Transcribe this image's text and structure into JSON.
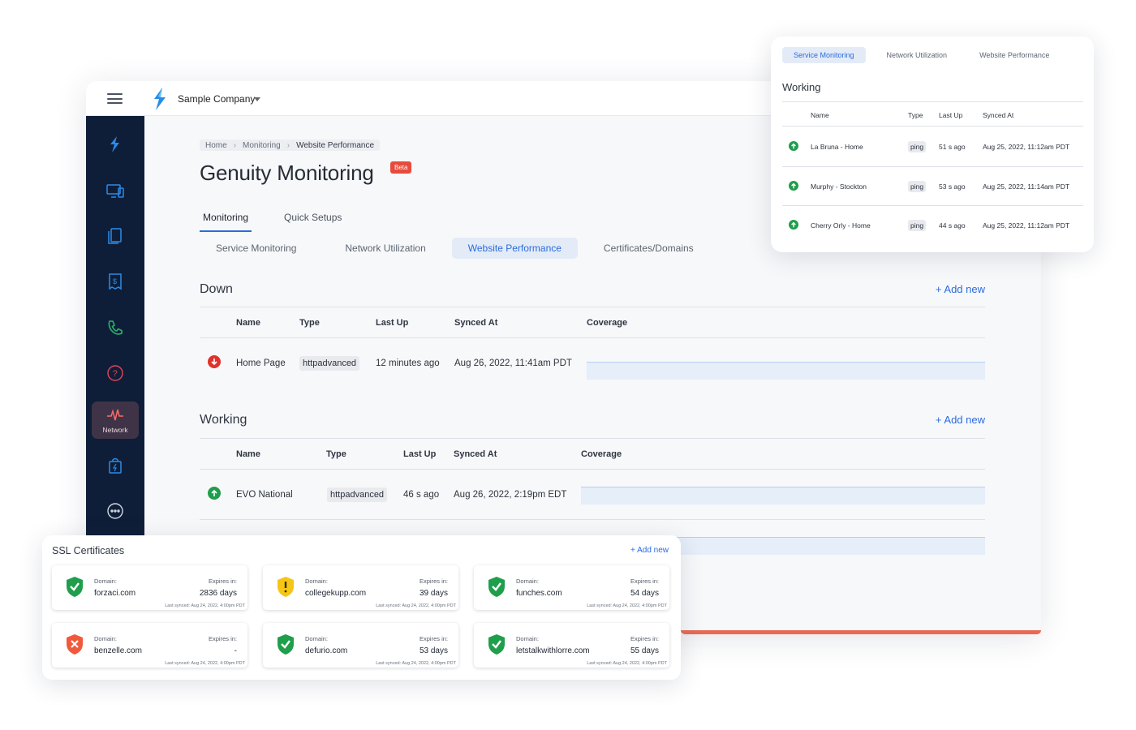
{
  "header": {
    "company": "Sample Company"
  },
  "sidebar": {
    "items": [
      {
        "icon": "brand-flame-icon"
      },
      {
        "icon": "devices-icon"
      },
      {
        "icon": "document-icon"
      },
      {
        "icon": "receipt-dollar-icon"
      },
      {
        "icon": "phone-icon"
      },
      {
        "icon": "help-circle-icon"
      },
      {
        "icon": "network-pulse-icon",
        "label": "Network",
        "active": true
      },
      {
        "icon": "shopping-bag-icon"
      },
      {
        "icon": "more-circle-icon"
      }
    ]
  },
  "breadcrumb": [
    "Home",
    "Monitoring",
    "Website Performance"
  ],
  "page": {
    "title": "Genuity Monitoring",
    "badge": "Beta"
  },
  "tabs": [
    "Monitoring",
    "Quick Setups"
  ],
  "subtabs": [
    "Service Monitoring",
    "Network Utilization",
    "Website Performance",
    "Certificates/Domains"
  ],
  "down": {
    "title": "Down",
    "add_label": "+ Add new",
    "columns": [
      "Name",
      "Type",
      "Last Up",
      "Synced At",
      "Coverage"
    ],
    "rows": [
      {
        "name": "Home Page",
        "type": "httpadvanced",
        "last_up": "12 minutes ago",
        "synced_at": "Aug 26, 2022, 11:41am PDT"
      }
    ]
  },
  "working": {
    "title": "Working",
    "add_label": "+ Add new",
    "columns": [
      "Name",
      "Type",
      "Last Up",
      "Synced At",
      "Coverage"
    ],
    "rows": [
      {
        "name": "EVO National",
        "type": "httpadvanced",
        "last_up": "46 s ago",
        "synced_at": "Aug 26, 2022, 2:19pm EDT"
      }
    ]
  },
  "float_card": {
    "tabs": [
      "Service Monitoring",
      "Network Utilization",
      "Website Performance"
    ],
    "title": "Working",
    "columns": [
      "Name",
      "Type",
      "Last Up",
      "Synced At"
    ],
    "rows": [
      {
        "name": "La Bruna - Home",
        "type": "ping",
        "last_up": "51 s ago",
        "synced_at": "Aug 25, 2022, 11:12am PDT"
      },
      {
        "name": "Murphy - Stockton",
        "type": "ping",
        "last_up": "53 s ago",
        "synced_at": "Aug 25, 2022, 11:14am PDT"
      },
      {
        "name": "Cherry Orly - Home",
        "type": "ping",
        "last_up": "44 s ago",
        "synced_at": "Aug 25, 2022, 11:12am PDT"
      }
    ]
  },
  "ssl": {
    "title": "SSL Certificates",
    "add_label": "+ Add new",
    "domain_label": "Domain:",
    "expires_label": "Expires in:",
    "certs": [
      {
        "domain": "forzaci.com",
        "expires": "2836 days",
        "synced": "Last synced: Aug 24, 2022, 4:00pm PDT",
        "status": "valid"
      },
      {
        "domain": "collegekupp.com",
        "expires": "39 days",
        "synced": "Last synced: Aug 24, 2022, 4:00pm PDT",
        "status": "warning"
      },
      {
        "domain": "funches.com",
        "expires": "54 days",
        "synced": "Last synced: Aug 24, 2022, 4:00pm PDT",
        "status": "valid"
      },
      {
        "domain": "benzelle.com",
        "expires": "-",
        "synced": "Last synced: Aug 24, 2022, 4:00pm PDT",
        "status": "expired"
      },
      {
        "domain": "defurio.com",
        "expires": "53 days",
        "synced": "Last synced: Aug 24, 2022, 4:00pm PDT",
        "status": "valid"
      },
      {
        "domain": "letstalkwithlorre.com",
        "expires": "55 days",
        "synced": "Last synced: Aug 24, 2022, 4:00pm PDT",
        "status": "valid"
      }
    ]
  },
  "colors": {
    "accent": "#2a6bde",
    "sidebar": "#0f1e38",
    "down": "#e0322b",
    "up": "#1f9e4c",
    "warning": "#f5c518",
    "beta": "#e84b3c"
  }
}
